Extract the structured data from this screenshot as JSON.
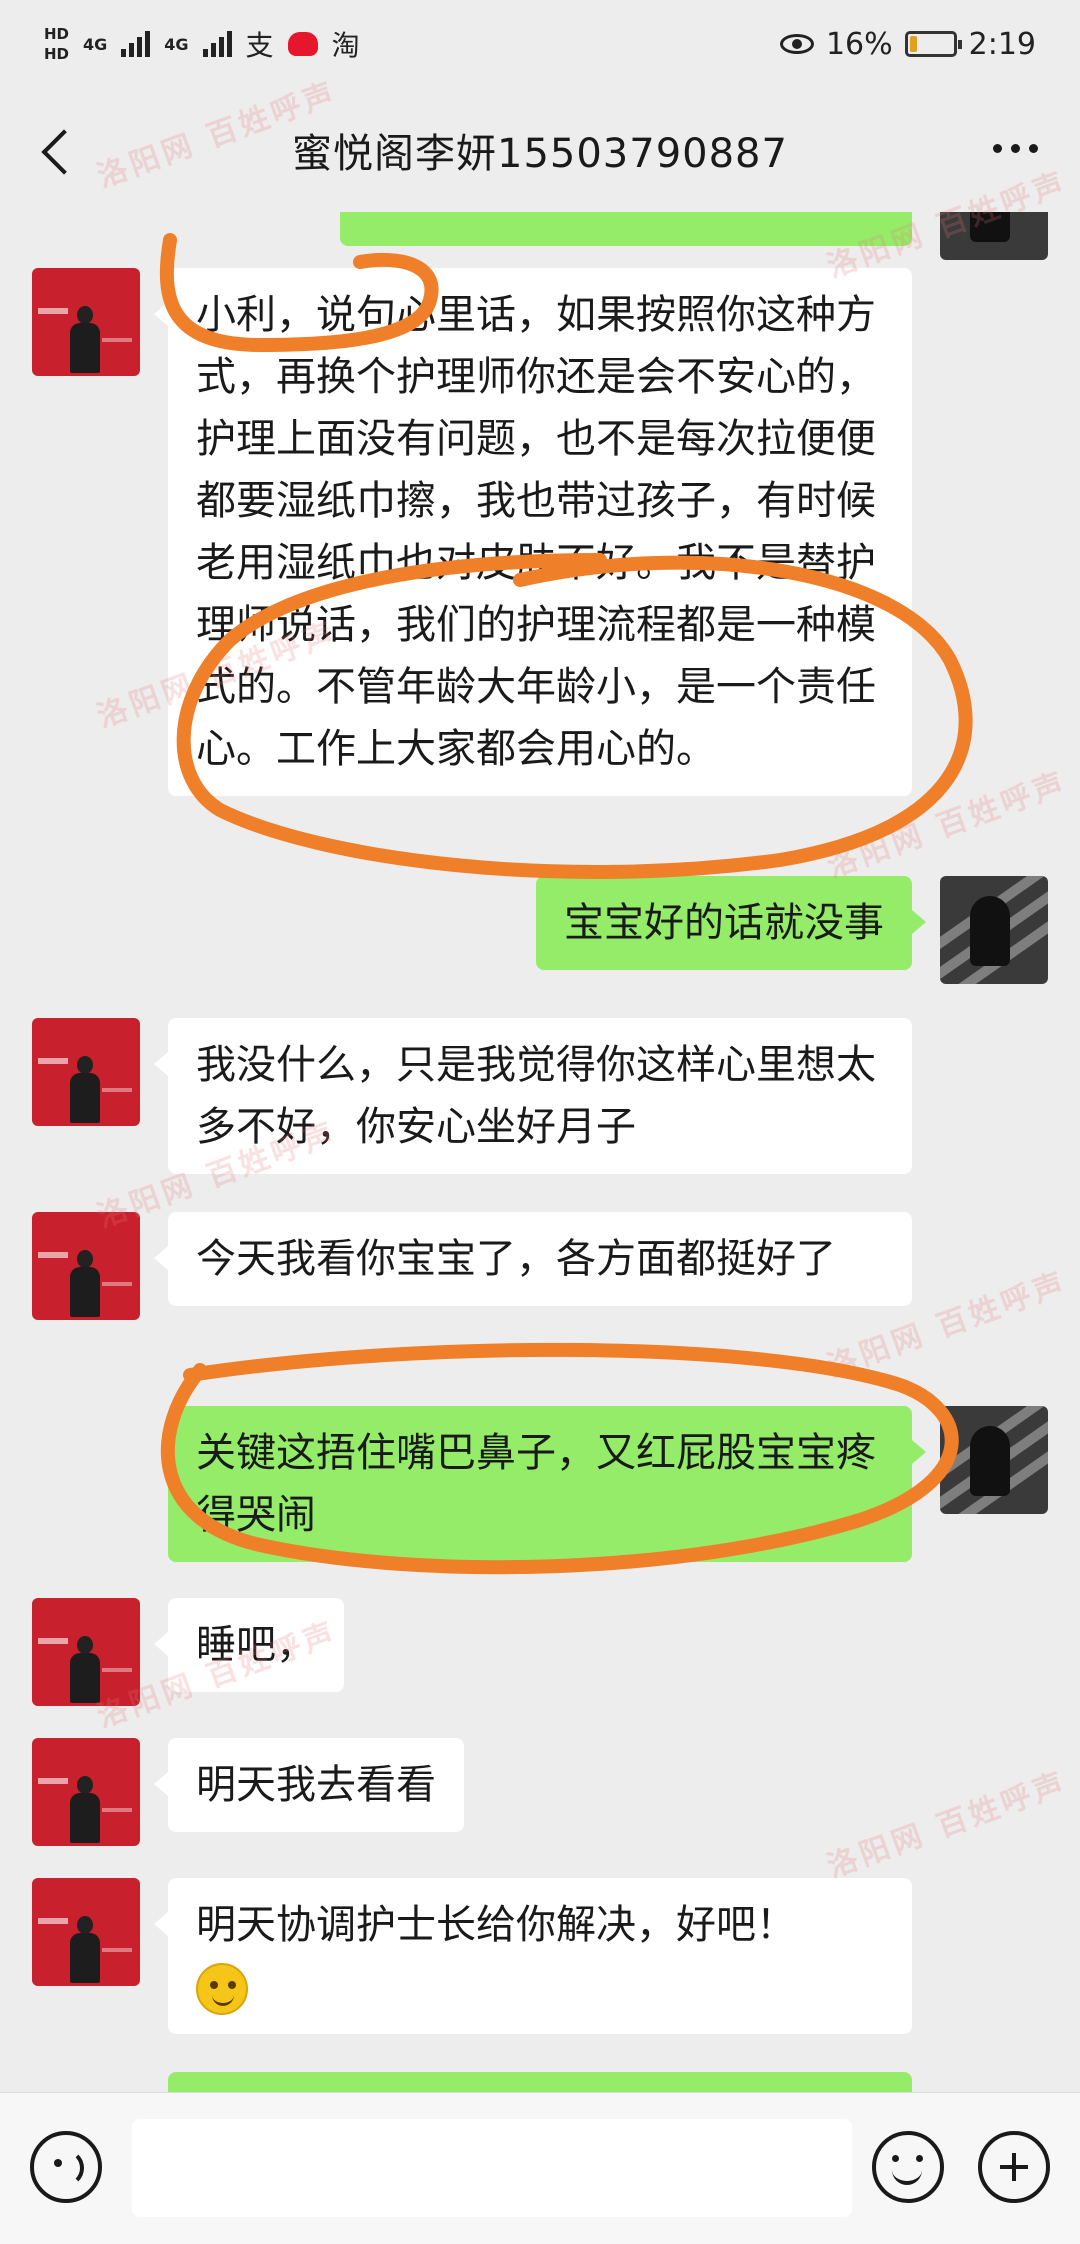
{
  "status_bar": {
    "hd1": "HD",
    "hd2": "HD",
    "net1": "4G",
    "net2": "4G",
    "app_icons": [
      "支",
      "淘"
    ],
    "battery_percent": "16%",
    "battery_level": 0.16,
    "time": "2:19"
  },
  "nav": {
    "title": "蜜悦阁李妍15503790887"
  },
  "messages": [
    {
      "side": "in",
      "text": "小利，说句心里话，如果按照你这种方式，再换个护理师你还是会不安心的，护理上面没有问题，也不是每次拉便便都要湿纸巾擦，我也带过孩子，有时候老用湿纸巾也对皮肤不好。我不是替护理师说话，我们的护理流程都是一种模式的。不管年龄大年龄小，是一个责任心。工作上大家都会用心的。"
    },
    {
      "side": "out",
      "text": "宝宝好的话就没事"
    },
    {
      "side": "in",
      "text": "我没什么，只是我觉得你这样心里想太多不好，你安心坐好月子"
    },
    {
      "side": "in",
      "text": "今天我看你宝宝了，各方面都挺好了"
    },
    {
      "side": "out",
      "text": "关键这捂住嘴巴鼻子，又红屁股宝宝疼得哭闹"
    },
    {
      "side": "in",
      "text": "睡吧，"
    },
    {
      "side": "in",
      "text": "明天我去看看"
    },
    {
      "side": "in",
      "text": "明天协调护士长给你解决，好吧！",
      "emoji": "smile-emoji"
    }
  ],
  "watermark": "洛阳网 百姓呼声",
  "colors": {
    "background": "#ededed",
    "incoming_bubble": "#ffffff",
    "outgoing_bubble": "#95ec69",
    "annotation": "#f07f2a",
    "avatar_red": "#c8202c"
  },
  "input": {
    "placeholder": ""
  }
}
